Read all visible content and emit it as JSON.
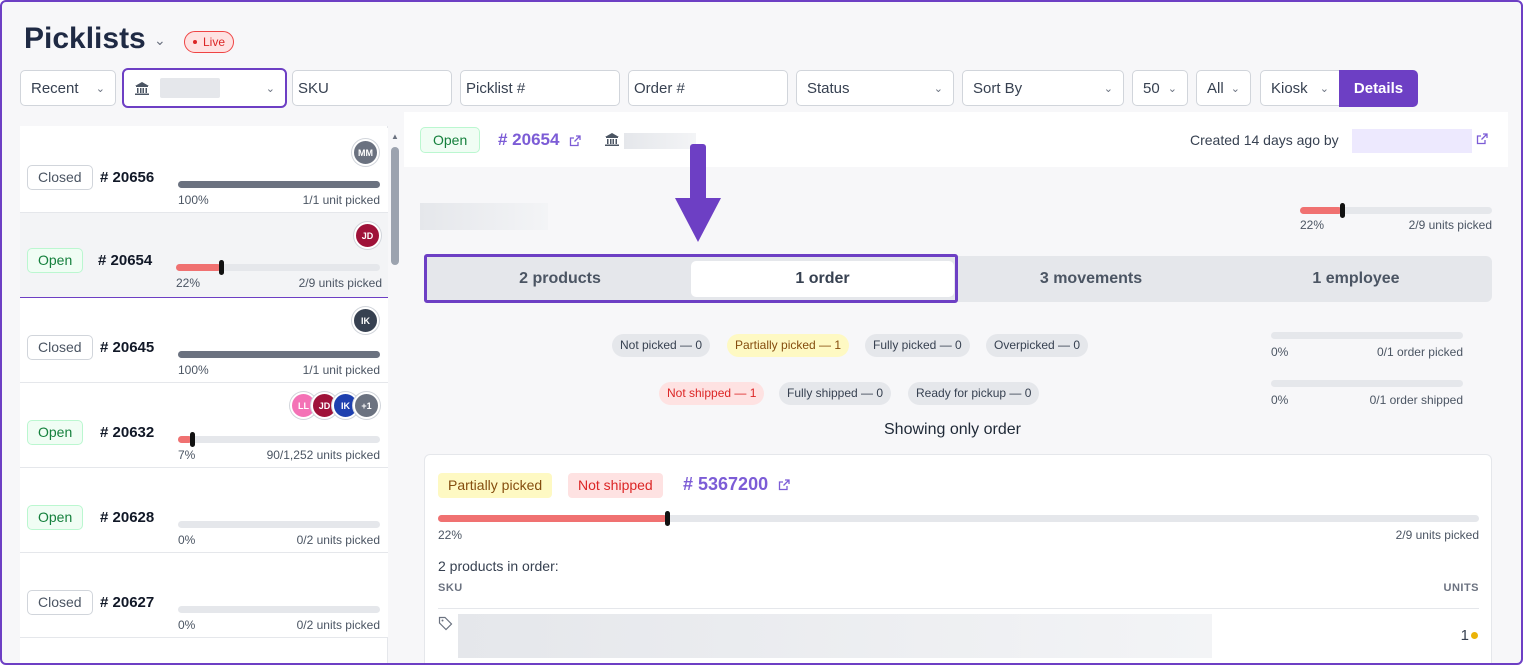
{
  "header": {
    "title": "Picklists",
    "live_label": "Live"
  },
  "toolbar": {
    "recent": "Recent",
    "sku_placeholder": "SKU",
    "picklist_placeholder": "Picklist #",
    "order_placeholder": "Order #",
    "status": "Status",
    "sort_by": "Sort By",
    "page_size": "50",
    "all": "All",
    "kiosk": "Kiosk",
    "details": "Details"
  },
  "list": {
    "items": [
      {
        "status": "Closed",
        "number": "# 20656",
        "pct": "100%",
        "units": "1/1 unit picked",
        "progress": 1.0,
        "avatars": [
          "MM"
        ]
      },
      {
        "status": "Open",
        "number": "# 20654",
        "pct": "22%",
        "units": "2/9 units picked",
        "progress": 0.22,
        "avatars": [
          "JD"
        ]
      },
      {
        "status": "Closed",
        "number": "# 20645",
        "pct": "100%",
        "units": "1/1 unit picked",
        "progress": 1.0,
        "avatars": [
          "IK"
        ]
      },
      {
        "status": "Open",
        "number": "# 20632",
        "pct": "7%",
        "units": "90/1,252 units picked",
        "progress": 0.07,
        "avatars": [
          "LL",
          "JD",
          "IK",
          "+1"
        ]
      },
      {
        "status": "Open",
        "number": "# 20628",
        "pct": "0%",
        "units": "0/2 units picked",
        "progress": 0,
        "avatars": []
      },
      {
        "status": "Closed",
        "number": "# 20627",
        "pct": "0%",
        "units": "0/2 units picked",
        "progress": 0,
        "avatars": []
      }
    ]
  },
  "detail": {
    "status": "Open",
    "number": "# 20654",
    "created": "Created 14 days ago by",
    "pct": "22%",
    "units": "2/9 units picked",
    "progress": 0.22,
    "tabs": [
      "2 products",
      "1 order",
      "3 movements",
      "1 employee"
    ],
    "active_tab": "1 order",
    "pick_chips": [
      "Not picked — 0",
      "Partially picked — 1",
      "Fully picked — 0",
      "Overpicked — 0"
    ],
    "ship_chips": [
      "Not shipped — 1",
      "Fully shipped — 0",
      "Ready for pickup — 0"
    ],
    "order_picked": {
      "pct": "0%",
      "label": "0/1 order picked"
    },
    "order_shipped": {
      "pct": "0%",
      "label": "0/1 order shipped"
    },
    "showing": "Showing only order"
  },
  "order": {
    "pick_status": "Partially picked",
    "ship_status": "Not shipped",
    "number": "# 5367200",
    "pct": "22%",
    "units": "2/9 units picked",
    "progress": 0.22,
    "products_label": "2 products in order:",
    "col_sku": "SKU",
    "col_units": "UNITS",
    "rows": [
      {
        "units": "1"
      }
    ]
  },
  "colors": {
    "accent": "#6d3fc4",
    "progress_red": "#f07171",
    "closed_bar": "#6b7280"
  }
}
